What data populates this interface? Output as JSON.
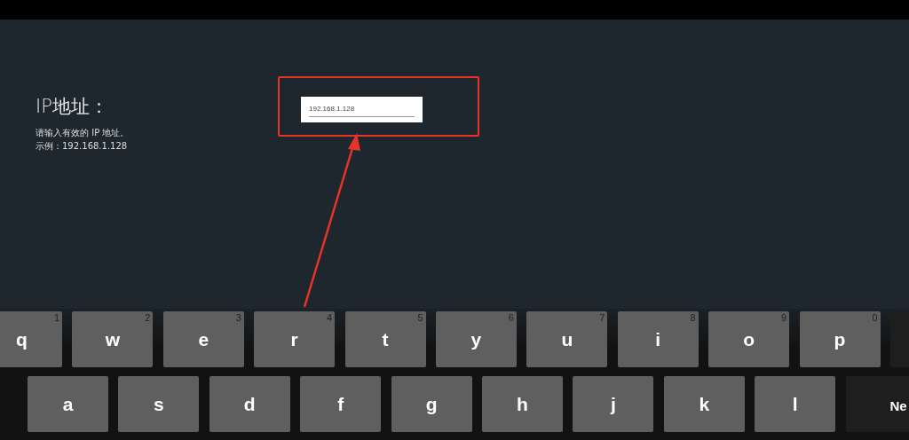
{
  "setting": {
    "title": "IP地址：",
    "hint": "请输入有效的 IP 地址。",
    "example": "示例：192.168.1.128"
  },
  "ip_field": {
    "value": "192.168.1.128"
  },
  "keyboard": {
    "rows": [
      {
        "keys": [
          {
            "label": "q",
            "hint": "1",
            "kind": "letter"
          },
          {
            "label": "w",
            "hint": "2",
            "kind": "letter"
          },
          {
            "label": "e",
            "hint": "3",
            "kind": "letter"
          },
          {
            "label": "r",
            "hint": "4",
            "kind": "letter"
          },
          {
            "label": "t",
            "hint": "5",
            "kind": "letter"
          },
          {
            "label": "y",
            "hint": "6",
            "kind": "letter"
          },
          {
            "label": "u",
            "hint": "7",
            "kind": "letter"
          },
          {
            "label": "i",
            "hint": "8",
            "kind": "letter"
          },
          {
            "label": "o",
            "hint": "9",
            "kind": "letter"
          },
          {
            "label": "p",
            "hint": "0",
            "kind": "letter"
          },
          {
            "kind": "action"
          }
        ]
      },
      {
        "keys": [
          {
            "label": "a",
            "kind": "letter"
          },
          {
            "label": "s",
            "kind": "letter"
          },
          {
            "label": "d",
            "kind": "letter"
          },
          {
            "label": "f",
            "kind": "letter"
          },
          {
            "label": "g",
            "kind": "letter"
          },
          {
            "label": "h",
            "kind": "letter"
          },
          {
            "label": "j",
            "kind": "letter"
          },
          {
            "label": "k",
            "kind": "letter"
          },
          {
            "label": "l",
            "kind": "letter"
          },
          {
            "label": "Ne",
            "kind": "action"
          }
        ]
      }
    ]
  }
}
